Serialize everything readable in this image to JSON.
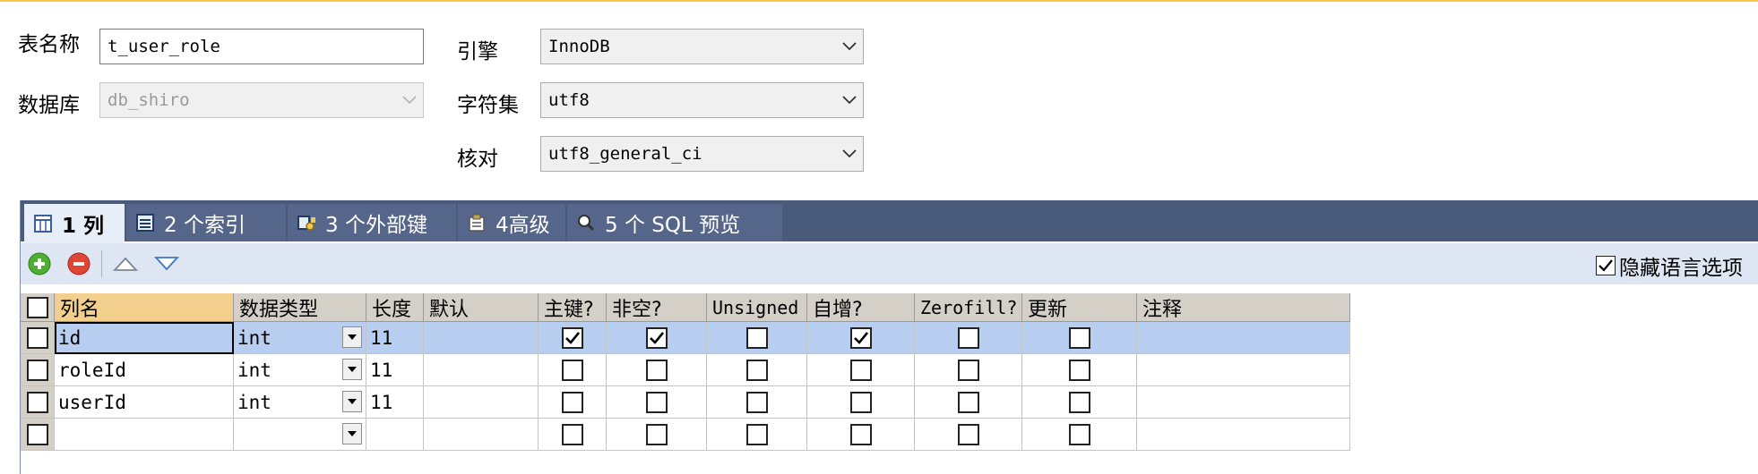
{
  "form": {
    "table_name_label": "表名称",
    "table_name_value": "t_user_role",
    "database_label": "数据库",
    "database_value": "db_shiro",
    "engine_label": "引擎",
    "engine_value": "InnoDB",
    "charset_label": "字符集",
    "charset_value": "utf8",
    "collation_label": "核对",
    "collation_value": "utf8_general_ci"
  },
  "tabs": [
    {
      "label": "1 列",
      "icon": "columns-icon",
      "active": true
    },
    {
      "label": "2 个索引",
      "icon": "index-icon",
      "active": false
    },
    {
      "label": "3 个外部键",
      "icon": "foreign-key-icon",
      "active": false
    },
    {
      "label": "4高级",
      "icon": "advanced-icon",
      "active": false
    },
    {
      "label": "5 个 SQL 预览",
      "icon": "sql-preview-icon",
      "active": false
    }
  ],
  "toolbar": {
    "add_icon": "add-column-icon",
    "remove_icon": "remove-column-icon",
    "up_icon": "move-up-icon",
    "down_icon": "move-down-icon",
    "hide_language_label": "隐藏语言选项",
    "hide_language_checked": true
  },
  "grid": {
    "headers": [
      "列名",
      "数据类型",
      "长度",
      "默认",
      "主键?",
      "非空?",
      "Unsigned",
      "自增?",
      "Zerofill?",
      "更新",
      "注释"
    ],
    "rows": [
      {
        "name": "id",
        "type": "int",
        "length": "11",
        "default": "",
        "pk": true,
        "not_null": true,
        "unsigned": false,
        "auto_inc": true,
        "zerofill": false,
        "update": false,
        "comment": ""
      },
      {
        "name": "roleId",
        "type": "int",
        "length": "11",
        "default": "",
        "pk": false,
        "not_null": false,
        "unsigned": false,
        "auto_inc": false,
        "zerofill": false,
        "update": false,
        "comment": ""
      },
      {
        "name": "userId",
        "type": "int",
        "length": "11",
        "default": "",
        "pk": false,
        "not_null": false,
        "unsigned": false,
        "auto_inc": false,
        "zerofill": false,
        "update": false,
        "comment": ""
      },
      {
        "name": "",
        "type": "",
        "length": "",
        "default": "",
        "pk": false,
        "not_null": false,
        "unsigned": false,
        "auto_inc": false,
        "zerofill": false,
        "update": false,
        "comment": ""
      }
    ]
  },
  "colors": {
    "tab_bar": "#4a5a7a",
    "selected_row": "#b8cef0",
    "sorted_header": "#f3cf8e"
  }
}
